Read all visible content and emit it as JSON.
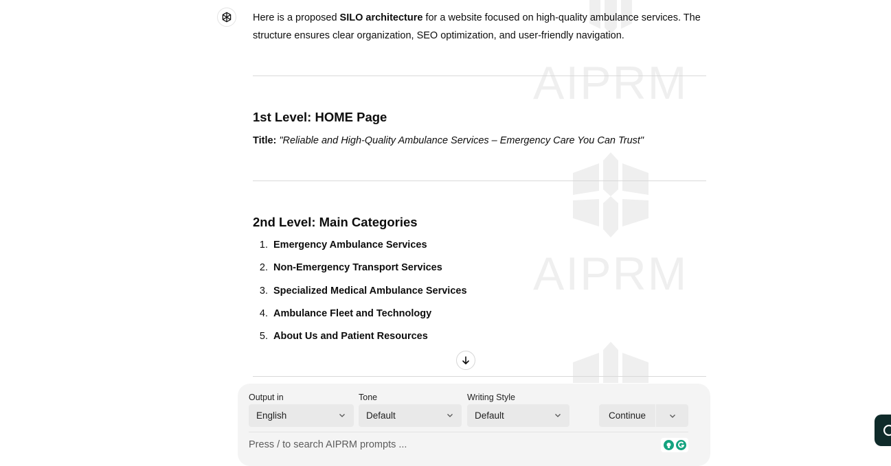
{
  "message": {
    "intro_pre": "Here is a proposed ",
    "intro_bold": "SILO architecture",
    "intro_post": " for a website focused on high-quality ambulance services. The structure ensures clear organization, SEO optimization, and user-friendly navigation.",
    "section1": {
      "heading": "1st Level: HOME Page",
      "title_label": "Title:",
      "title_value": "\"Reliable and High-Quality Ambulance Services – Emergency Care You Can Trust\""
    },
    "section2": {
      "heading": "2nd Level: Main Categories",
      "items": [
        {
          "num": "1.",
          "label": "Emergency Ambulance Services"
        },
        {
          "num": "2.",
          "label": "Non-Emergency Transport Services"
        },
        {
          "num": "3.",
          "label": "Specialized Medical Ambulance Services"
        },
        {
          "num": "4.",
          "label": "Ambulance Fleet and Technology"
        },
        {
          "num": "5.",
          "label": "About Us and Patient Resources"
        }
      ]
    }
  },
  "watermark": {
    "text": "AIPRM"
  },
  "toolbar": {
    "output_label": "Output in",
    "output_value": "English",
    "tone_label": "Tone",
    "tone_value": "Default",
    "style_label": "Writing Style",
    "style_value": "Default",
    "continue_label": "Continue"
  },
  "prompt_search": {
    "placeholder": "Press / to search AIPRM prompts ..."
  },
  "icons": {
    "avatar": "openai-logo-icon",
    "scroll": "arrow-down-icon",
    "dropdown": "chevron-down-icon",
    "ext1": "bulb-icon",
    "ext2": "grammarly-icon"
  },
  "colors": {
    "accent_green": "#14a37f",
    "panel_bg": "#f4f4f4",
    "select_bg": "#e9e9e9"
  }
}
